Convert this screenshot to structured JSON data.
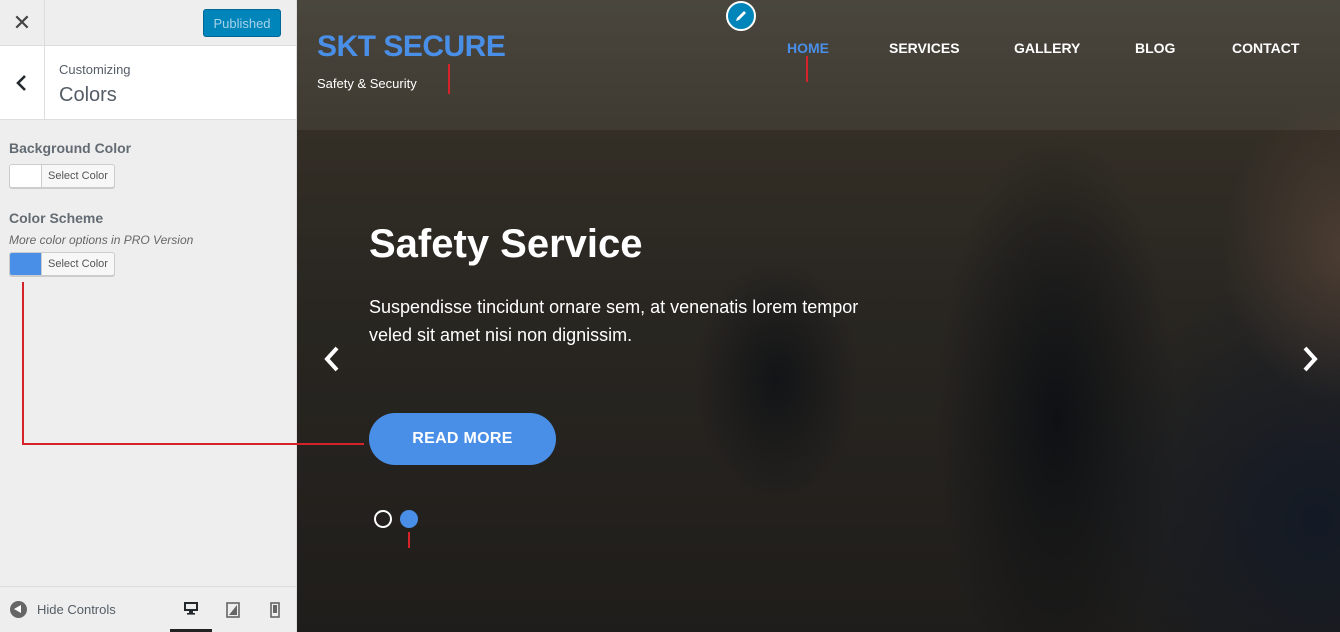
{
  "customizer": {
    "close_icon": "close-icon",
    "publish_label": "Published",
    "breadcrumb": "Customizing",
    "section_title": "Colors",
    "background_color": {
      "label": "Background Color",
      "button_label": "Select Color",
      "value": "#ffffff"
    },
    "color_scheme": {
      "label": "Color Scheme",
      "description": "More color options in PRO Version",
      "button_label": "Select Color",
      "value": "#4a8fe7"
    },
    "footer": {
      "hide_controls_label": "Hide Controls",
      "devices": [
        "desktop",
        "tablet",
        "mobile"
      ],
      "active_device": "desktop"
    }
  },
  "site": {
    "logo": "SKT SECURE",
    "tagline": "Safety & Security",
    "nav": [
      "HOME",
      "SERVICES",
      "GALLERY",
      "BLOG",
      "CONTACT"
    ],
    "active_nav": "HOME",
    "slider": {
      "title": "Safety Service",
      "text": "Suspendisse tincidunt ornare sem, at venenatis lorem tempor veled sit amet nisi non dignissim.",
      "button_label": "READ MORE",
      "slide_count": 2,
      "active_slide": 2
    }
  },
  "colors": {
    "accent": "#4a8fe7",
    "publish": "#0085ba",
    "highlight_line": "#d6232a"
  }
}
